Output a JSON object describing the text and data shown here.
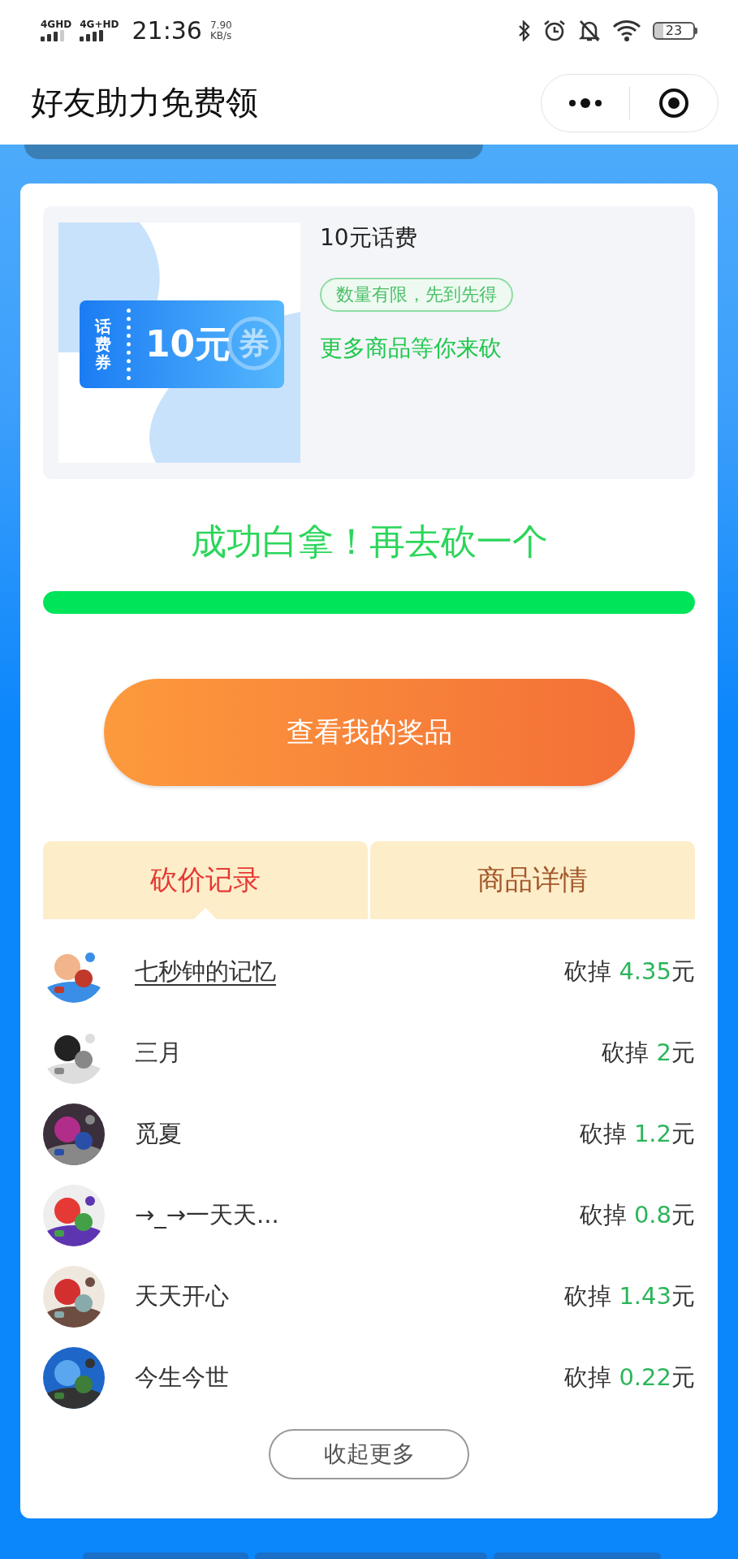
{
  "status_bar": {
    "network_1": "4GHD",
    "network_2": "4G+HD",
    "time": "21:36",
    "speed": "7.90",
    "speed_unit": "KB/s",
    "battery": "23"
  },
  "nav_bar": {
    "title": "好友助力免费领"
  },
  "product": {
    "coupon": {
      "label": "话费券",
      "amount": "10元",
      "stamp": "券"
    },
    "name": "10元话费",
    "tag": "数量有限，先到先得",
    "link": "更多商品等你来砍"
  },
  "result_text": "成功白拿！再去砍一个",
  "progress": {
    "level": 1
  },
  "main_button": "查看我的奖品",
  "tabs": [
    {
      "label": "砍价记录",
      "selected": true
    },
    {
      "label": "商品详情",
      "selected": false
    }
  ],
  "records": [
    {
      "name": "七秒钟的记忆",
      "underlined": true,
      "prefix": "砍掉",
      "amount": "4.35",
      "unit": "元"
    },
    {
      "name": "三月",
      "underlined": false,
      "prefix": "砍掉",
      "amount": "2",
      "unit": "元"
    },
    {
      "name": "觅夏",
      "underlined": false,
      "prefix": "砍掉",
      "amount": "1.2",
      "unit": "元"
    },
    {
      "name": "→_→一天天...",
      "underlined": false,
      "prefix": "砍掉",
      "amount": "0.8",
      "unit": "元"
    },
    {
      "name": "天天开心",
      "underlined": false,
      "prefix": "砍掉",
      "amount": "1.43",
      "unit": "元"
    },
    {
      "name": "今生今世",
      "underlined": false,
      "prefix": "砍掉",
      "amount": "0.22",
      "unit": "元"
    }
  ],
  "collapse_button": "收起更多"
}
